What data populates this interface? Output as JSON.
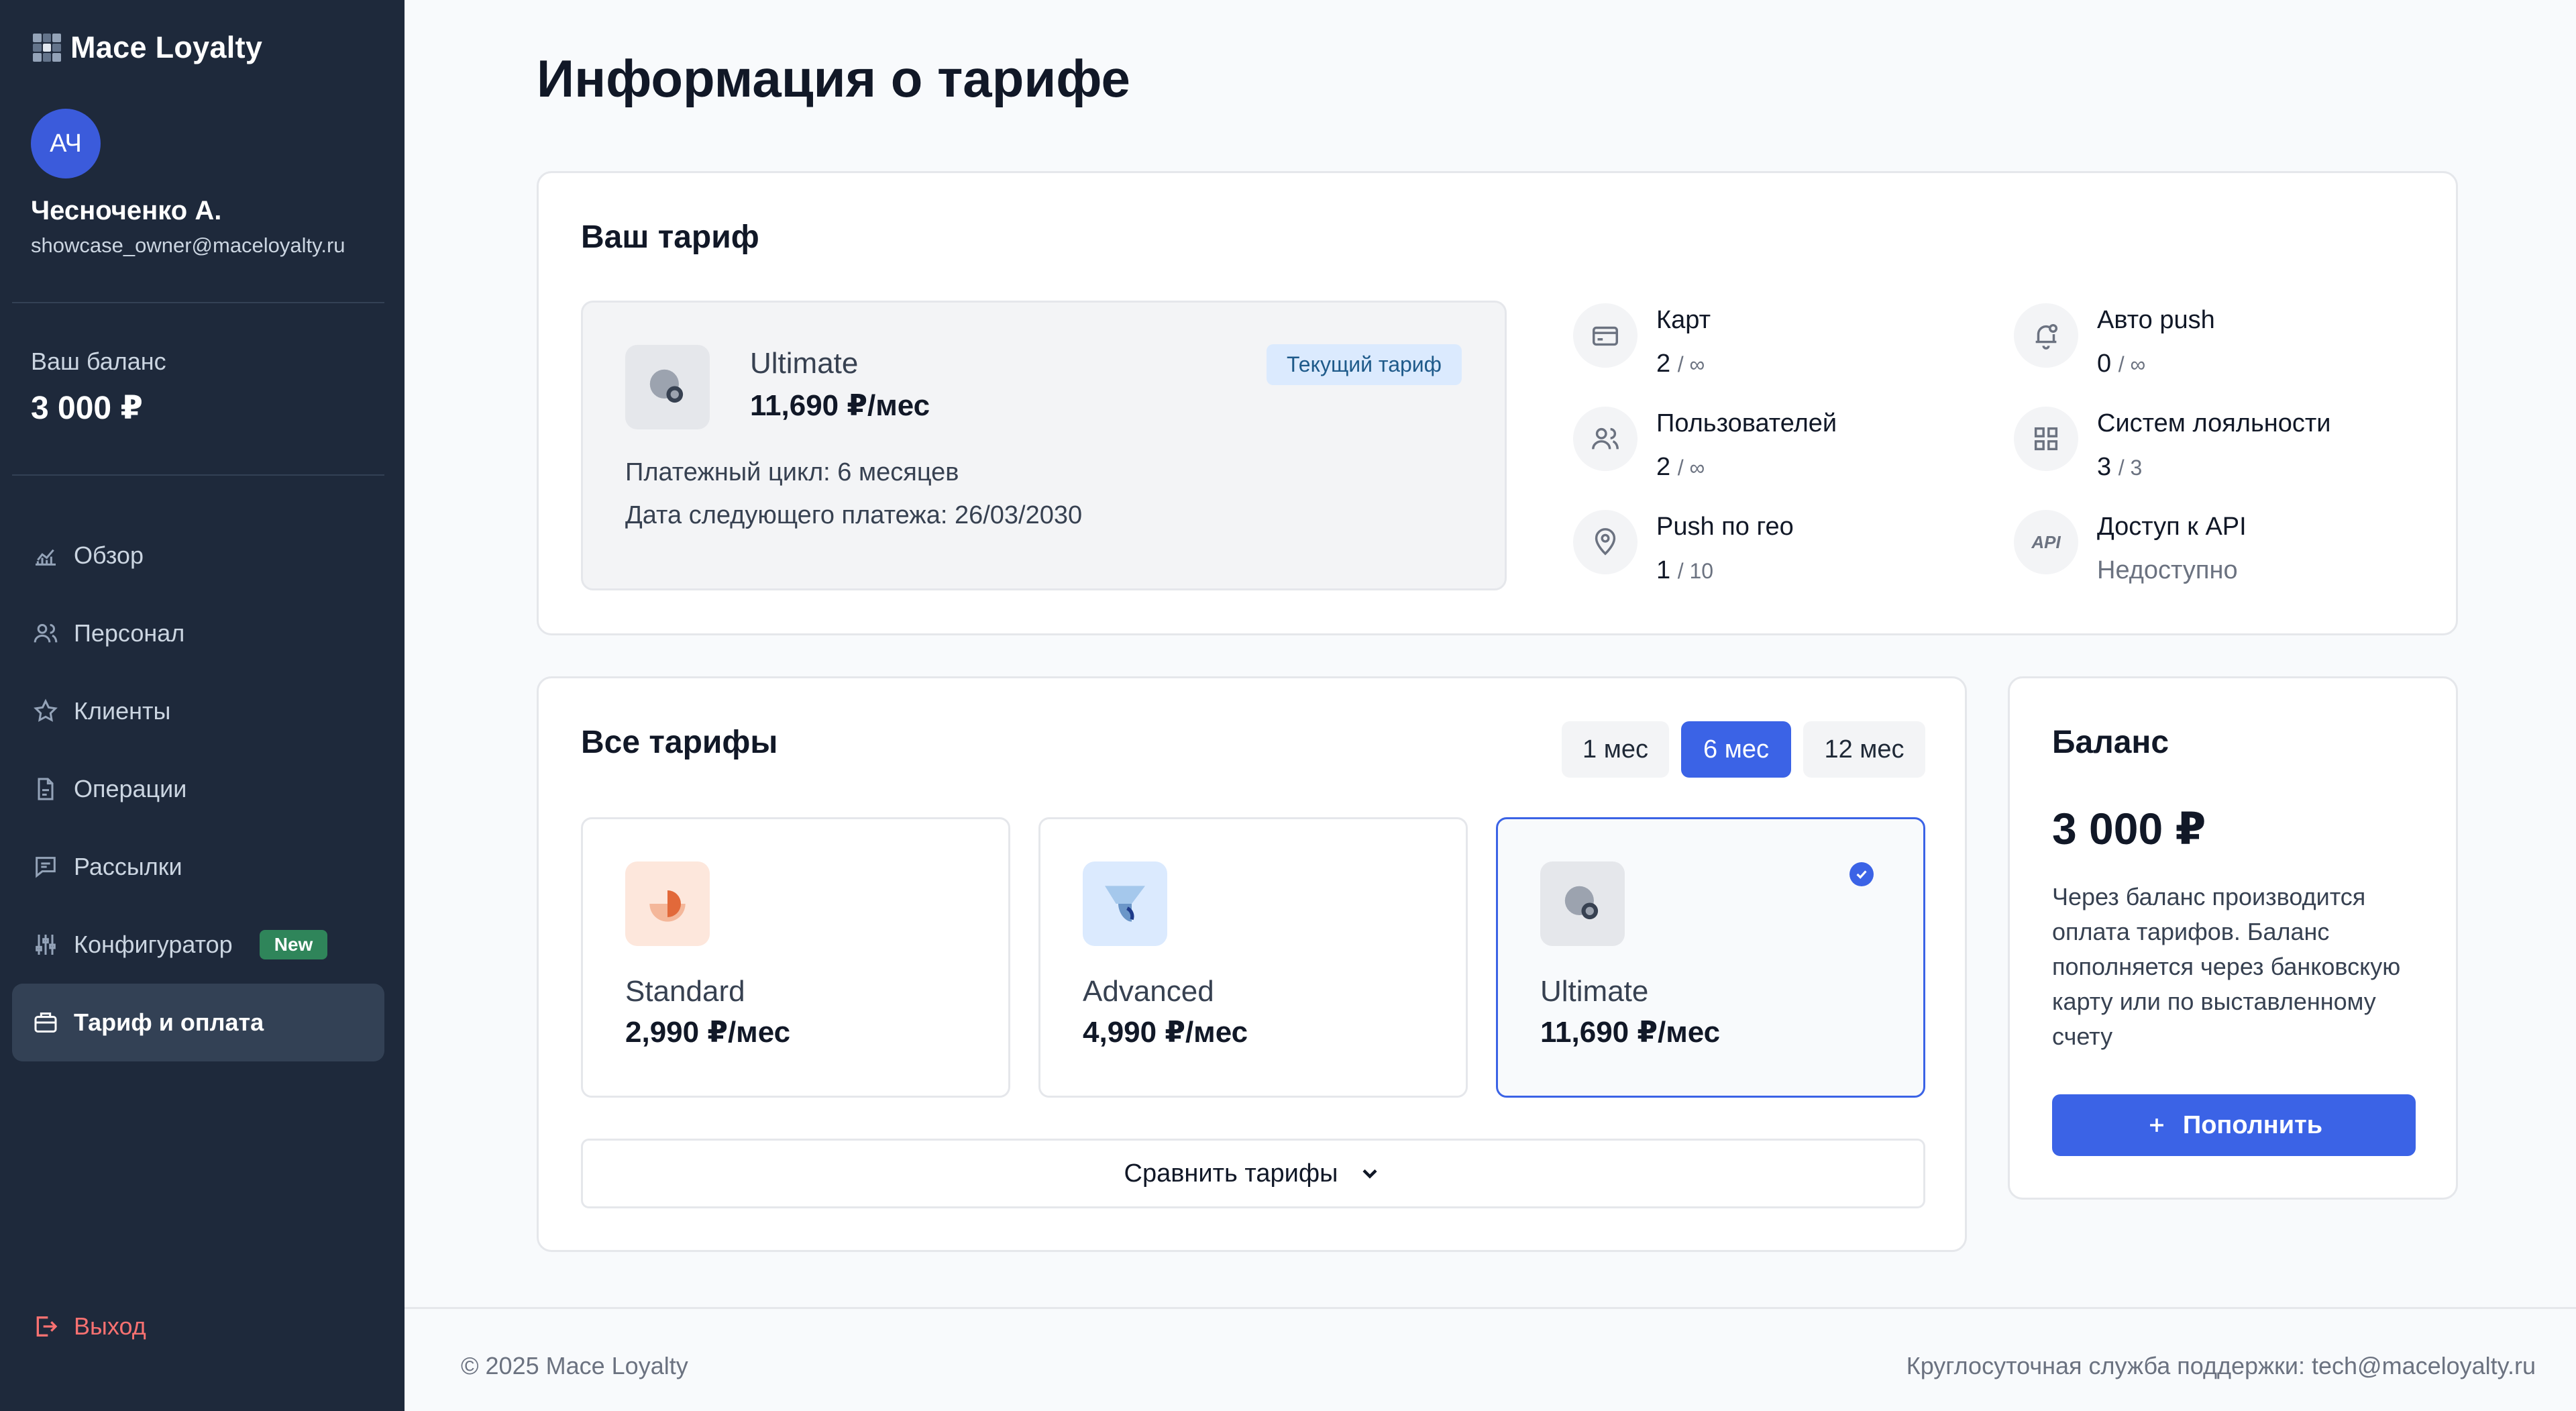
{
  "brand": {
    "name": "Mace Loyalty"
  },
  "user": {
    "initials": "АЧ",
    "name": "Чесноченко А.",
    "email": "showcase_owner@maceloyalty.ru"
  },
  "sidebar_balance": {
    "label": "Ваш баланс",
    "value": "3 000 ₽"
  },
  "nav": {
    "items": [
      {
        "label": "Обзор",
        "icon": "chart-icon"
      },
      {
        "label": "Персонал",
        "icon": "users-icon"
      },
      {
        "label": "Клиенты",
        "icon": "star-icon"
      },
      {
        "label": "Операции",
        "icon": "document-icon"
      },
      {
        "label": "Рассылки",
        "icon": "message-icon"
      },
      {
        "label": "Конфигуратор",
        "icon": "sliders-icon",
        "badge": "New"
      },
      {
        "label": "Тариф и оплата",
        "icon": "briefcase-icon",
        "active": true
      }
    ],
    "logout": "Выход"
  },
  "page": {
    "title": "Информация о тарифе"
  },
  "current_plan": {
    "heading": "Ваш тариф",
    "name": "Ultimate",
    "price": "11,690 ₽/мес",
    "badge": "Текущий тариф",
    "cycle": "Платежный цикл: 6 месяцев",
    "next_payment": "Дата следующего платежа: 26/03/2030",
    "stats": [
      {
        "label": "Карт",
        "value": "2",
        "limit": "/ ∞",
        "icon": "card-icon"
      },
      {
        "label": "Авто push",
        "value": "0",
        "limit": "/ ∞",
        "icon": "bell-icon"
      },
      {
        "label": "Пользователей",
        "value": "2",
        "limit": "/ ∞",
        "icon": "users-icon"
      },
      {
        "label": "Систем лояльности",
        "value": "3",
        "limit": "/ 3",
        "icon": "grid-icon"
      },
      {
        "label": "Push по гео",
        "value": "1",
        "limit": "/ 10",
        "icon": "location-icon"
      },
      {
        "label": "Доступ к API",
        "value": "Недоступно",
        "limit": "",
        "icon": "api-icon",
        "icon_text": "API"
      }
    ]
  },
  "all_plans": {
    "heading": "Все тарифы",
    "periods": [
      "1 мес",
      "6 мес",
      "12 мес"
    ],
    "selected_period": "6 мес",
    "plans": [
      {
        "name": "Standard",
        "price": "2,990 ₽/мес"
      },
      {
        "name": "Advanced",
        "price": "4,990 ₽/мес"
      },
      {
        "name": "Ultimate",
        "price": "11,690 ₽/мес",
        "selected": true
      }
    ],
    "compare_label": "Сравнить тарифы"
  },
  "balance_card": {
    "heading": "Баланс",
    "value": "3 000 ₽",
    "description": "Через баланс производится оплата тарифов. Баланс пополняется через банковскую карту или по выставленному счету",
    "button": "Пополнить"
  },
  "footer": {
    "copyright": "© 2025 Mace Loyalty",
    "support": "Круглосуточная служба поддержки: tech@maceloyalty.ru"
  },
  "colors": {
    "sidebar": "#1e293b",
    "accent": "#3b63e6",
    "logout": "#f87171",
    "badge_new": "#2f855a"
  }
}
